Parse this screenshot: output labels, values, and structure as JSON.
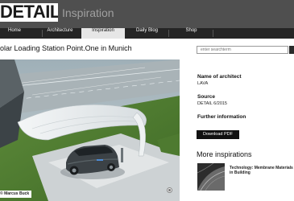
{
  "header": {
    "logo": "DETAIL",
    "logo_sub": "Inspiration"
  },
  "nav": {
    "items": [
      {
        "label": "Home"
      },
      {
        "label": "Architecture"
      },
      {
        "label": "Inspiration"
      },
      {
        "label": "Daily Blog"
      },
      {
        "label": "Shop"
      }
    ],
    "active": "Inspiration"
  },
  "search": {
    "placeholder": "enter searchterm"
  },
  "article": {
    "title": "olar Loading Station Point.One in Munich",
    "photo_credit": "Marcus Buck"
  },
  "info": {
    "architect_label": "Name of architect",
    "architect_value": "LAVA",
    "source_label": "Source",
    "source_value": "DETAIL 6/2015",
    "further_label": "Further information",
    "download_label": "Download PDF"
  },
  "more": {
    "heading": "More inspirations",
    "items": [
      {
        "title": "Technology: Membrane Materials in Building"
      }
    ]
  },
  "colors": {
    "header_bg": "#4f4f4f",
    "nav_bg": "#252525",
    "nav_active_bg": "#e6e6e6",
    "button_bg": "#111111"
  }
}
